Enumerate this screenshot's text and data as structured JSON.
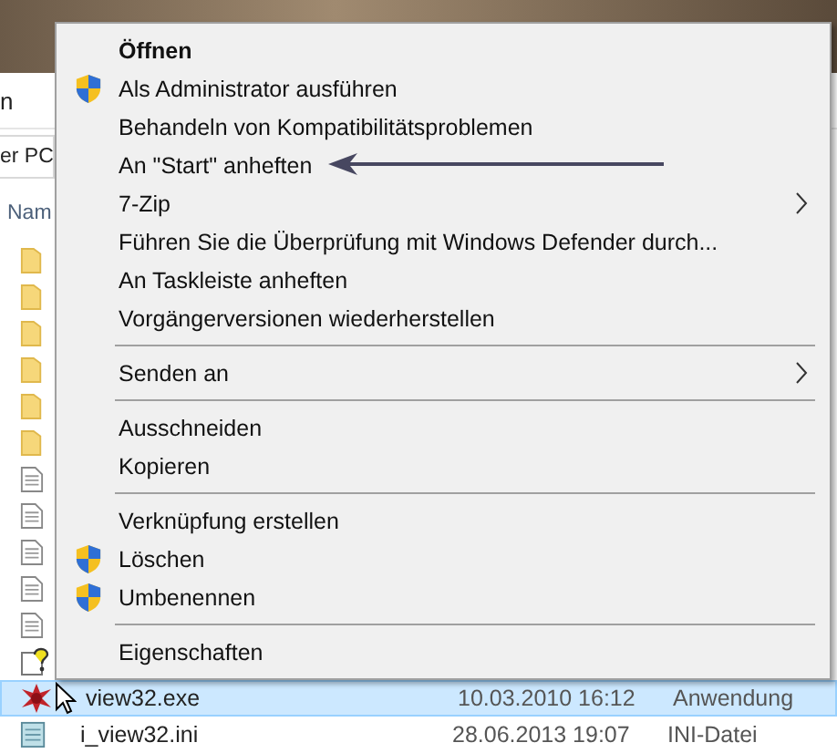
{
  "explorer": {
    "ribbon_tab": "n",
    "address": "er PC",
    "column_header": "Nam",
    "files": [
      {
        "kind": "folder",
        "selected": false
      },
      {
        "kind": "folder",
        "selected": false
      },
      {
        "kind": "folder",
        "selected": false
      },
      {
        "kind": "folder",
        "selected": false
      },
      {
        "kind": "folder",
        "selected": false
      },
      {
        "kind": "folder",
        "selected": false
      },
      {
        "kind": "document",
        "selected": false
      },
      {
        "kind": "document",
        "selected": false
      },
      {
        "kind": "document",
        "selected": false
      },
      {
        "kind": "document",
        "selected": false
      },
      {
        "kind": "document",
        "selected": false
      },
      {
        "kind": "help",
        "selected": false
      },
      {
        "kind": "exe",
        "name": "view32.exe",
        "date": "10.03.2010 16:12",
        "type": "Anwendung",
        "selected": true
      },
      {
        "kind": "ini",
        "name": "i_view32.ini",
        "date": "28.06.2013 19:07",
        "type": "INI-Datei",
        "selected": false
      }
    ]
  },
  "context_menu": [
    {
      "kind": "item",
      "label": "Öffnen",
      "bold": true,
      "shield": false,
      "submenu": false
    },
    {
      "kind": "item",
      "label": "Als Administrator ausführen",
      "bold": false,
      "shield": true,
      "submenu": false
    },
    {
      "kind": "item",
      "label": "Behandeln von Kompatibilitätsproblemen",
      "bold": false,
      "shield": false,
      "submenu": false
    },
    {
      "kind": "item",
      "label": "An \"Start\" anheften",
      "bold": false,
      "shield": false,
      "submenu": false,
      "annotated": true
    },
    {
      "kind": "item",
      "label": "7-Zip",
      "bold": false,
      "shield": false,
      "submenu": true
    },
    {
      "kind": "item",
      "label": "Führen Sie die Überprüfung mit Windows Defender durch...",
      "bold": false,
      "shield": false,
      "submenu": false
    },
    {
      "kind": "item",
      "label": "An Taskleiste anheften",
      "bold": false,
      "shield": false,
      "submenu": false
    },
    {
      "kind": "item",
      "label": "Vorgängerversionen wiederherstellen",
      "bold": false,
      "shield": false,
      "submenu": false
    },
    {
      "kind": "separator"
    },
    {
      "kind": "item",
      "label": "Senden an",
      "bold": false,
      "shield": false,
      "submenu": true
    },
    {
      "kind": "separator"
    },
    {
      "kind": "item",
      "label": "Ausschneiden",
      "bold": false,
      "shield": false,
      "submenu": false
    },
    {
      "kind": "item",
      "label": "Kopieren",
      "bold": false,
      "shield": false,
      "submenu": false
    },
    {
      "kind": "separator"
    },
    {
      "kind": "item",
      "label": "Verknüpfung erstellen",
      "bold": false,
      "shield": false,
      "submenu": false
    },
    {
      "kind": "item",
      "label": "Löschen",
      "bold": false,
      "shield": true,
      "submenu": false
    },
    {
      "kind": "item",
      "label": "Umbenennen",
      "bold": false,
      "shield": true,
      "submenu": false
    },
    {
      "kind": "separator"
    },
    {
      "kind": "item",
      "label": "Eigenschaften",
      "bold": false,
      "shield": false,
      "submenu": false
    }
  ]
}
